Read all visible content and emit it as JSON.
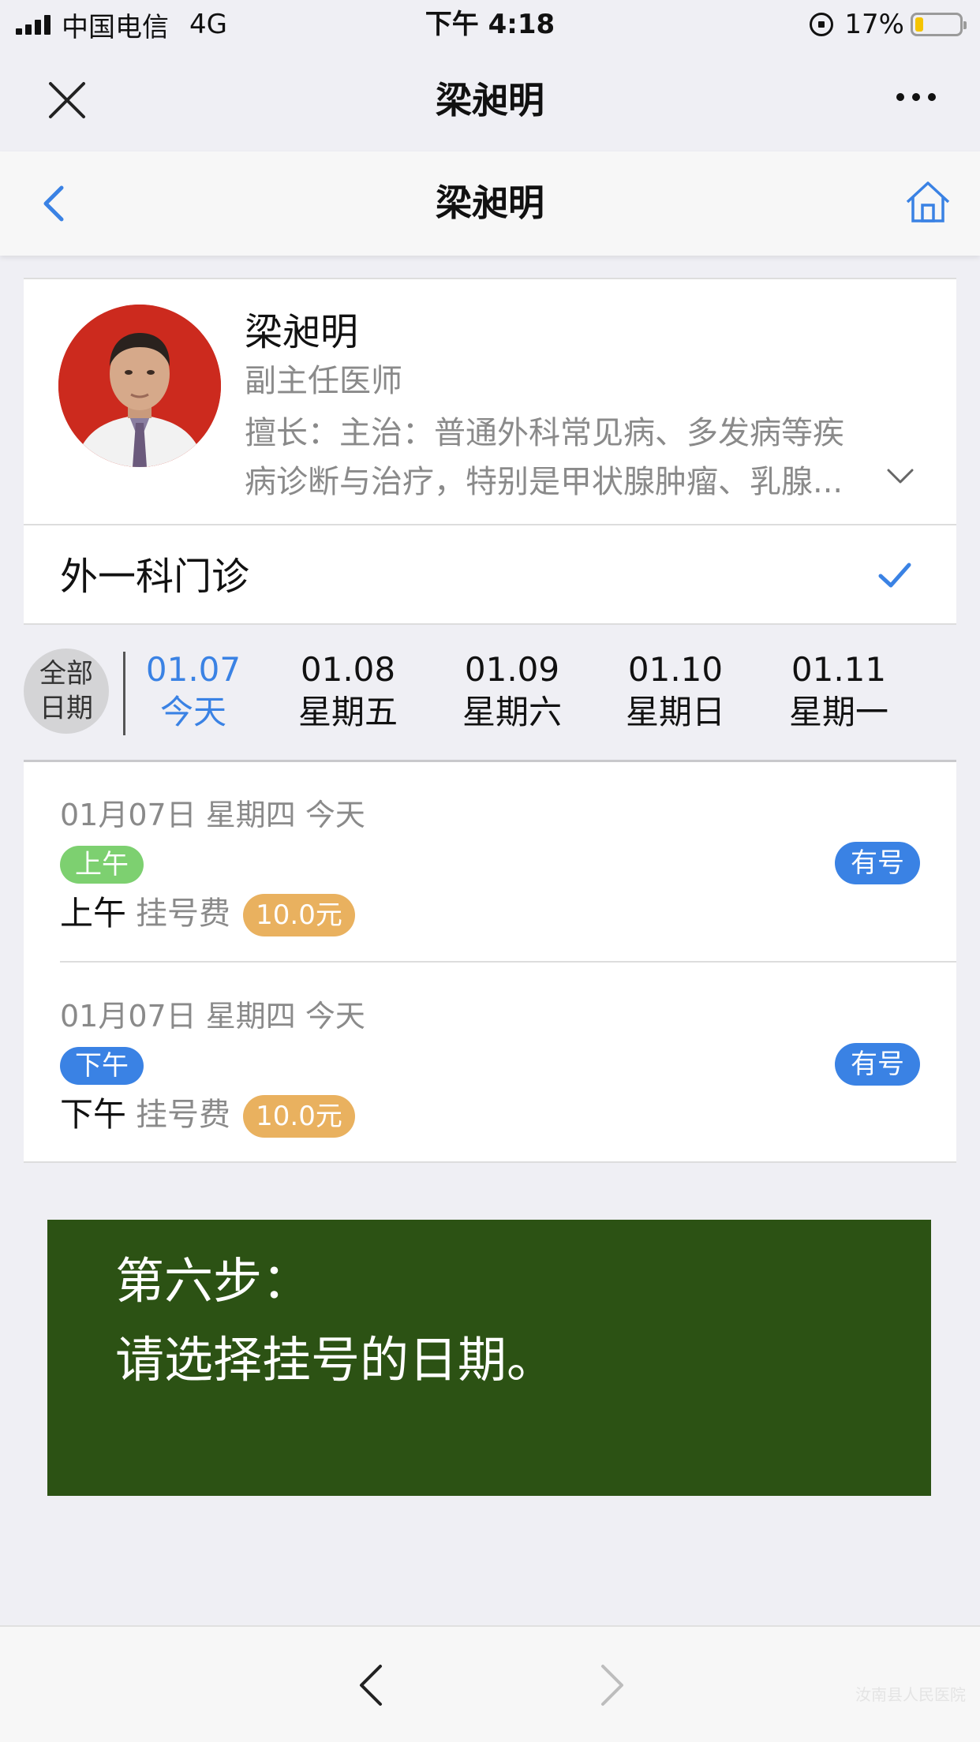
{
  "status_bar": {
    "carrier": "中国电信",
    "network": "4G",
    "time": "下午 4:18",
    "battery": "17%",
    "battery_level": 0.17
  },
  "wechat_bar": {
    "title": "梁昶明",
    "close_icon": "close-icon",
    "more_icon": "more-icon"
  },
  "page_header": {
    "title": "梁昶明",
    "back_icon": "chevron-left-icon",
    "home_icon": "home-icon"
  },
  "doctor": {
    "name": "梁昶明",
    "title": "副主任医师",
    "specialty_line1": "擅长：主治：普通外科常见病、多发病等疾",
    "specialty_line2": "病诊断与治疗，特别是甲状腺肿瘤、乳腺...",
    "expand_icon": "chevron-down-icon"
  },
  "department": {
    "name": "外一科门诊",
    "selected_icon": "check-icon"
  },
  "date_bar": {
    "all_dates_line1": "全部",
    "all_dates_line2": "日期",
    "dates": [
      {
        "date": "01.07",
        "day": "今天"
      },
      {
        "date": "01.08",
        "day": "星期五"
      },
      {
        "date": "01.09",
        "day": "星期六"
      },
      {
        "date": "01.10",
        "day": "星期日"
      },
      {
        "date": "01.11",
        "day": "星期一"
      }
    ]
  },
  "slots": [
    {
      "date_text": "01月07日  星期四  今天",
      "tag": "上午",
      "period": "上午",
      "fee_label": "挂号费",
      "fee": "10.0元",
      "availability": "有号"
    },
    {
      "date_text": "01月07日  星期四  今天",
      "tag": "下午",
      "period": "下午",
      "fee_label": "挂号费",
      "fee": "10.0元",
      "availability": "有号"
    }
  ],
  "notice": {
    "line1": "第六步：",
    "line2": "请选择挂号的日期。"
  },
  "bottom_bar": {
    "back_icon": "chevron-left-icon",
    "forward_icon": "chevron-right-icon",
    "watermark": "汝南县人民医院"
  },
  "colors": {
    "accent_blue": "#3a82e4",
    "morning_green": "#7dd070",
    "fee_orange": "#e9b15f",
    "notice_green": "#2c5214"
  }
}
